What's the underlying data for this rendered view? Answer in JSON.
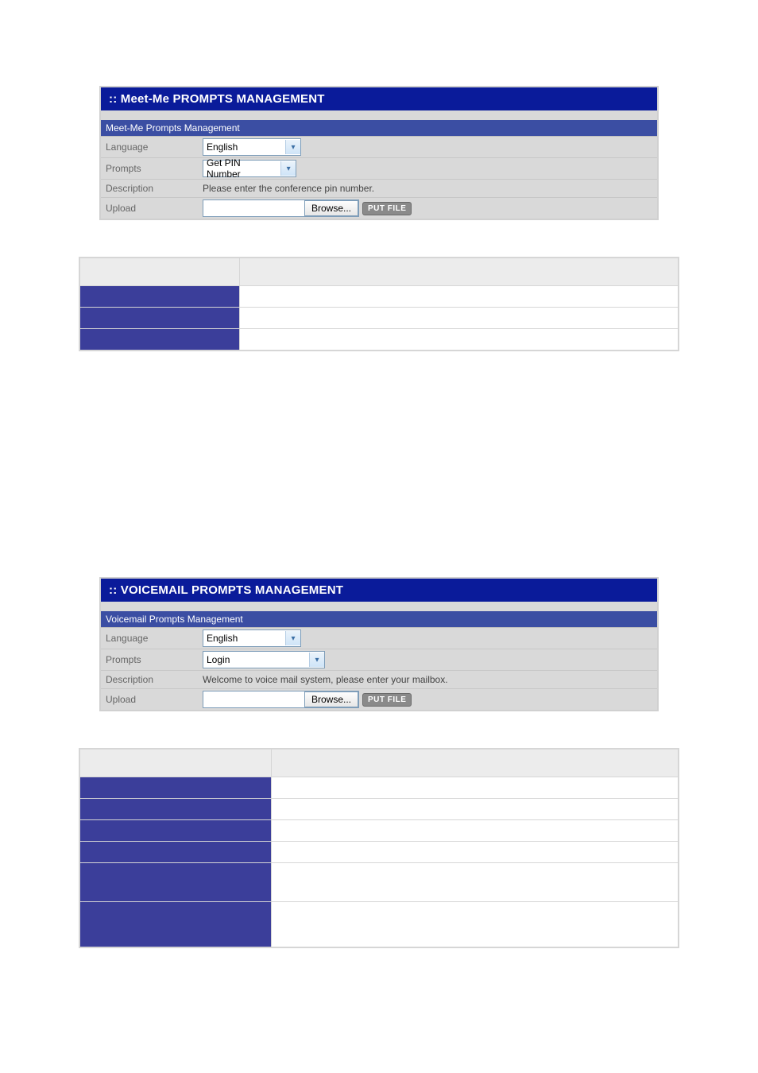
{
  "panel1": {
    "title": " :: Meet-Me PROMPTS MANAGEMENT",
    "subtitle": "Meet-Me Prompts Management",
    "rows": {
      "language_label": "Language",
      "language_value": "English",
      "prompts_label": "Prompts",
      "prompts_value": "Get PIN Number",
      "description_label": "Description",
      "description_value": "Please enter the conference pin number.",
      "upload_label": "Upload",
      "browse_label": "Browse...",
      "put_label": "PUT FILE"
    }
  },
  "ref_table1": {
    "rows": [
      {
        "left": "",
        "right": ""
      },
      {
        "left": "",
        "right": ""
      },
      {
        "left": "",
        "right": ""
      },
      {
        "left": "",
        "right": ""
      }
    ]
  },
  "panel2": {
    "title": " :: VOICEMAIL PROMPTS MANAGEMENT",
    "subtitle": "Voicemail Prompts Management",
    "rows": {
      "language_label": "Language",
      "language_value": "English",
      "prompts_label": "Prompts",
      "prompts_value": "Login",
      "description_label": "Description",
      "description_value": "Welcome to voice mail system, please enter your mailbox.",
      "upload_label": "Upload",
      "browse_label": "Browse...",
      "put_label": "PUT FILE"
    }
  },
  "ref_table2": {
    "rows": [
      {
        "left": "",
        "right": ""
      },
      {
        "left": "",
        "right": ""
      },
      {
        "left": "",
        "right": ""
      },
      {
        "left": "",
        "right": ""
      },
      {
        "left": "",
        "right": ""
      },
      {
        "left": "",
        "right": ""
      },
      {
        "left": "",
        "right": ""
      }
    ]
  }
}
